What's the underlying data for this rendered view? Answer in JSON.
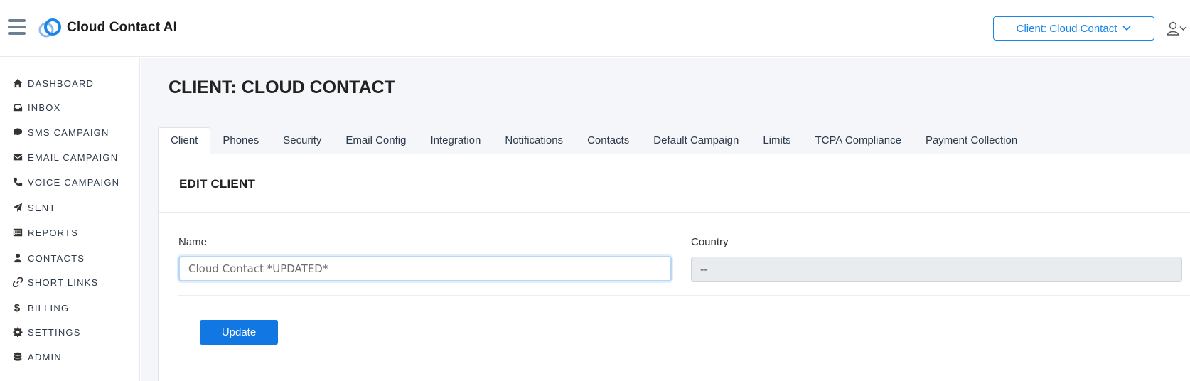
{
  "app": {
    "brand": "Cloud Contact AI",
    "client_selector": "Client: Cloud Contact"
  },
  "sidebar": {
    "items": [
      {
        "label": "DASHBOARD",
        "icon": "home-icon"
      },
      {
        "label": "INBOX",
        "icon": "inbox-icon"
      },
      {
        "label": "SMS CAMPAIGN",
        "icon": "chat-bubble-icon"
      },
      {
        "label": "EMAIL CAMPAIGN",
        "icon": "envelope-icon"
      },
      {
        "label": "VOICE CAMPAIGN",
        "icon": "phone-icon"
      },
      {
        "label": "SENT",
        "icon": "paper-plane-icon"
      },
      {
        "label": "REPORTS",
        "icon": "list-report-icon"
      },
      {
        "label": "CONTACTS",
        "icon": "user-icon"
      },
      {
        "label": "SHORT LINKS",
        "icon": "link-icon"
      },
      {
        "label": "BILLING",
        "icon": "dollar-icon"
      },
      {
        "label": "SETTINGS",
        "icon": "gear-icon"
      },
      {
        "label": "ADMIN",
        "icon": "database-icon"
      }
    ]
  },
  "main": {
    "page_title": "CLIENT: CLOUD CONTACT",
    "tabs": [
      {
        "label": "Client",
        "active": true
      },
      {
        "label": "Phones"
      },
      {
        "label": "Security"
      },
      {
        "label": "Email Config"
      },
      {
        "label": "Integration"
      },
      {
        "label": "Notifications"
      },
      {
        "label": "Contacts"
      },
      {
        "label": "Default Campaign"
      },
      {
        "label": "Limits"
      },
      {
        "label": "TCPA Compliance"
      },
      {
        "label": "Payment Collection"
      }
    ],
    "panel": {
      "title": "EDIT CLIENT",
      "name_label": "Name",
      "name_value": "Cloud Contact *UPDATED*",
      "country_label": "Country",
      "country_value": "--",
      "update_button": "Update"
    }
  },
  "colors": {
    "accent": "#1177e3",
    "brand_blue": "#1a86e8",
    "main_bg": "#f4f6f9"
  }
}
